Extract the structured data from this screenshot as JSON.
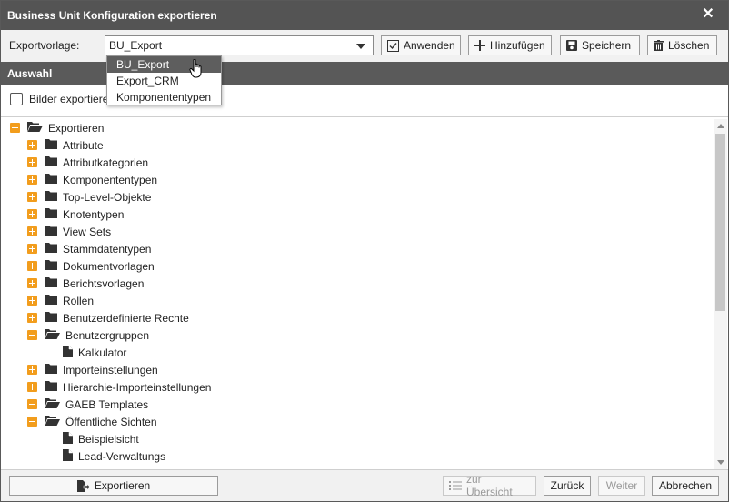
{
  "window": {
    "title": "Business Unit Konfiguration exportieren",
    "close_icon": "close-icon"
  },
  "toolbar": {
    "template_label": "Exportvorlage:",
    "template_value": "BU_Export",
    "apply": "Anwenden",
    "add": "Hinzufügen",
    "save": "Speichern",
    "delete": "Löschen"
  },
  "dropdown": {
    "options": [
      "BU_Export",
      "Export_CRM",
      "Komponententypen"
    ],
    "selected_index": 0
  },
  "section": {
    "title": "Auswahl",
    "images_checkbox_label": "Bilder exportieren",
    "images_checked": false
  },
  "tree": {
    "nodes": [
      {
        "label": "Exportieren",
        "toggle": "minus",
        "icon": "folder-open"
      },
      {
        "label": "Attribute",
        "toggle": "plus",
        "icon": "folder"
      },
      {
        "label": "Attributkategorien",
        "toggle": "plus",
        "icon": "folder"
      },
      {
        "label": "Komponententypen",
        "toggle": "plus",
        "icon": "folder"
      },
      {
        "label": "Top-Level-Objekte",
        "toggle": "plus",
        "icon": "folder"
      },
      {
        "label": "Knotentypen",
        "toggle": "plus",
        "icon": "folder"
      },
      {
        "label": "View Sets",
        "toggle": "plus",
        "icon": "folder"
      },
      {
        "label": "Stammdatentypen",
        "toggle": "plus",
        "icon": "folder"
      },
      {
        "label": "Dokumentvorlagen",
        "toggle": "plus",
        "icon": "folder"
      },
      {
        "label": "Berichtsvorlagen",
        "toggle": "plus",
        "icon": "folder"
      },
      {
        "label": "Rollen",
        "toggle": "plus",
        "icon": "folder"
      },
      {
        "label": "Benutzerdefinierte Rechte",
        "toggle": "plus",
        "icon": "folder"
      },
      {
        "label": "Benutzergruppen",
        "toggle": "minus",
        "icon": "folder-open"
      },
      {
        "label": "Kalkulator",
        "toggle": "none",
        "icon": "file"
      },
      {
        "label": "Importeinstellungen",
        "toggle": "plus",
        "icon": "folder"
      },
      {
        "label": "Hierarchie-Importeinstellungen",
        "toggle": "plus",
        "icon": "folder"
      },
      {
        "label": "GAEB Templates",
        "toggle": "minus",
        "icon": "folder-open"
      },
      {
        "label": "Öffentliche Sichten",
        "toggle": "minus",
        "icon": "folder-open"
      },
      {
        "label": "Beispielsicht",
        "toggle": "none",
        "icon": "file"
      },
      {
        "label": "Lead-Verwaltungs",
        "toggle": "none",
        "icon": "file"
      }
    ]
  },
  "footer": {
    "export": "Exportieren",
    "overview": "zur Übersicht",
    "back": "Zurück",
    "next": "Weiter",
    "cancel": "Abbrechen"
  }
}
